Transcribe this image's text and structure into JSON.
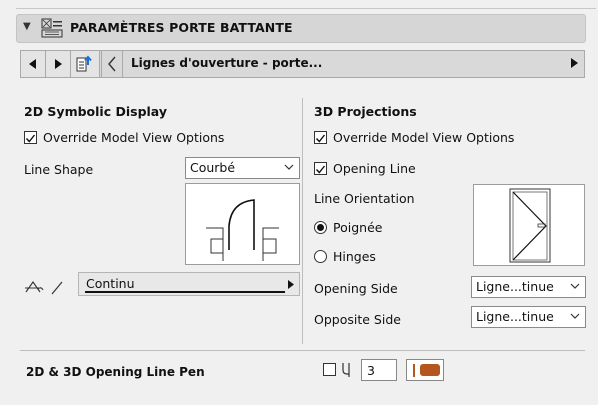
{
  "panel": {
    "title": "PARAMÈTRES PORTE BATTANTE"
  },
  "navigator": {
    "current_label": "Lignes d'ouverture - porte..."
  },
  "symbolic_2d": {
    "title": "2D Symbolic Display",
    "override_label": "Override Model View Options",
    "override_checked": true,
    "line_shape_label": "Line Shape",
    "line_shape_value": "Courbé",
    "line_type_value": "Continu"
  },
  "projections_3d": {
    "title": "3D Projections",
    "override_label": "Override Model View Options",
    "override_checked": true,
    "opening_line_label": "Opening Line",
    "opening_line_checked": true,
    "line_orientation_label": "Line Orientation",
    "orientation_options": [
      "Poignée",
      "Hinges"
    ],
    "orientation_selected": "Poignée",
    "opening_side_label": "Opening Side",
    "opening_side_value": "Ligne...tinue",
    "opposite_side_label": "Opposite Side",
    "opposite_side_value": "Ligne...tinue"
  },
  "pen": {
    "label": "2D & 3D Opening Line Pen",
    "pen_number": "3",
    "pen_color": "#b5561f",
    "checked": false
  }
}
